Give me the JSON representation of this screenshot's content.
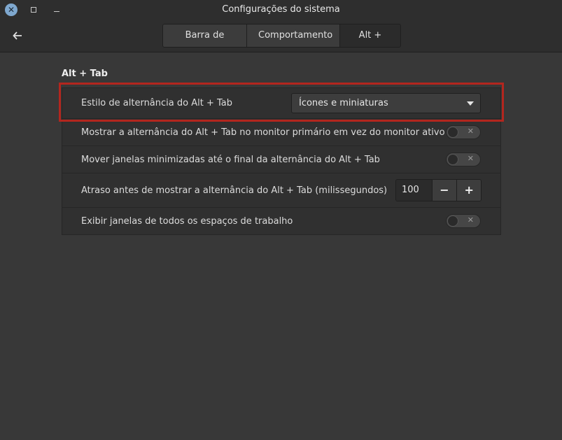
{
  "window": {
    "title": "Configurações do sistema",
    "close_glyph": "✕",
    "back_glyph": "🡐"
  },
  "tabs": [
    {
      "label": "Barra de título",
      "active": false
    },
    {
      "label": "Comportamento",
      "active": false
    },
    {
      "label": "Alt + Tab",
      "active": true
    }
  ],
  "section": {
    "title": "Alt + Tab"
  },
  "settings": {
    "switcher_style": {
      "label": "Estilo de alternância do Alt + Tab",
      "value": "Ícones e miniaturas"
    },
    "primary_monitor": {
      "label": "Mostrar a alternância do Alt + Tab no monitor primário em vez do monitor ativo",
      "enabled": false,
      "off_glyph": "✕"
    },
    "minimized_last": {
      "label": "Mover janelas minimizadas até o final da alternância do Alt + Tab",
      "enabled": false,
      "off_glyph": "✕"
    },
    "delay": {
      "label": "Atraso antes de mostrar a alternância do Alt + Tab (milissegundos)",
      "value": "100",
      "minus": "−",
      "plus": "+"
    },
    "all_workspaces": {
      "label": "Exibir janelas de todos os espaços de trabalho",
      "enabled": false,
      "off_glyph": "✕"
    }
  },
  "colors": {
    "highlight": "#b3261e",
    "close_button": "#7fa8cf"
  }
}
